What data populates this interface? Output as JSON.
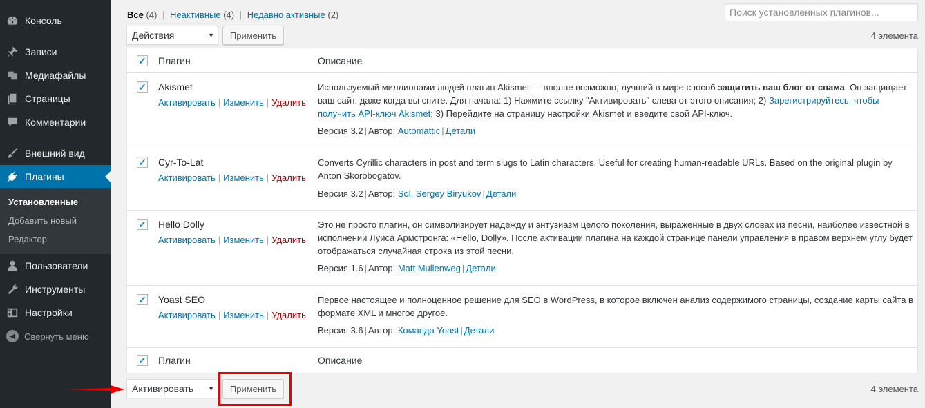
{
  "sidebar": {
    "items": [
      {
        "label": "Консоль",
        "icon": "dashboard-icon"
      },
      {
        "label": "Записи",
        "icon": "pin-icon"
      },
      {
        "label": "Медиафайлы",
        "icon": "media-icon"
      },
      {
        "label": "Страницы",
        "icon": "pages-icon"
      },
      {
        "label": "Комментарии",
        "icon": "comment-icon"
      },
      {
        "label": "Внешний вид",
        "icon": "brush-icon"
      },
      {
        "label": "Плагины",
        "icon": "plugin-icon"
      },
      {
        "label": "Пользователи",
        "icon": "user-icon"
      },
      {
        "label": "Инструменты",
        "icon": "wrench-icon"
      },
      {
        "label": "Настройки",
        "icon": "settings-icon"
      }
    ],
    "submenu": [
      "Установленные",
      "Добавить новый",
      "Редактор"
    ],
    "collapse_label": "Свернуть меню"
  },
  "filters": {
    "all_label": "Все",
    "all_count": "(4)",
    "inactive_label": "Неактивные",
    "inactive_count": "(4)",
    "recent_label": "Недавно активные",
    "recent_count": "(2)"
  },
  "search": {
    "placeholder": "Поиск установленных плагинов..."
  },
  "bulk_top": {
    "select_value": "Действия",
    "apply_label": "Применить",
    "count": "4 элемента"
  },
  "bulk_bottom": {
    "select_value": "Активировать",
    "apply_label": "Применить",
    "count": "4 элемента"
  },
  "table": {
    "col_plugin": "Плагин",
    "col_description": "Описание",
    "action_activate": "Активировать",
    "action_edit": "Изменить",
    "action_delete": "Удалить",
    "version_prefix": "Версия",
    "author_prefix": "Автор:",
    "details_label": "Детали",
    "plugins": [
      {
        "name": "Akismet",
        "desc_1": "Используемый миллионами людей плагин Akismet — вполне возможно, лучший в мире способ ",
        "desc_bold": "защитить ваш блог от спама",
        "desc_2": ". Он защищает ваш сайт, даже когда вы спите. Для начала: 1) Нажмите ссылку \"Активировать\" слева от этого описания; 2) ",
        "desc_link": "Зарегистрируйтесь, чтобы получить API-ключ Akismet",
        "desc_3": "; 3) Перейдите на страницу настройки Akismet и введите свой API-ключ.",
        "version": "3.2",
        "author": "Automattic"
      },
      {
        "name": "Cyr-To-Lat",
        "desc": "Converts Cyrillic characters in post and term slugs to Latin characters. Useful for creating human-readable URLs. Based on the original plugin by Anton Skorobogatov.",
        "version": "3.2",
        "author": "Sol, Sergey Biryukov"
      },
      {
        "name": "Hello Dolly",
        "desc": "Это не просто плагин, он символизирует надежду и энтузиазм целого поколения, выраженные в двух словах из песни, наиболее известной в исполнении Луиса Армстронга: «Hello, Dolly». После активации плагина на каждой странице панели управления в правом верхнем углу будет отображаться случайная строка из этой песни.",
        "version": "1.6",
        "author": "Matt Mullenweg"
      },
      {
        "name": "Yoast SEO",
        "desc": "Первое настоящее и полноценное решение для SEO в WordPress, в которое включен анализ содержимого страницы, создание карты сайта в формате XML и многое другое.",
        "version": "3.6",
        "author": "Команда Yoast"
      }
    ]
  },
  "colors": {
    "accent": "#0073aa",
    "sidebar": "#23282d",
    "highlight": "#e00000"
  }
}
